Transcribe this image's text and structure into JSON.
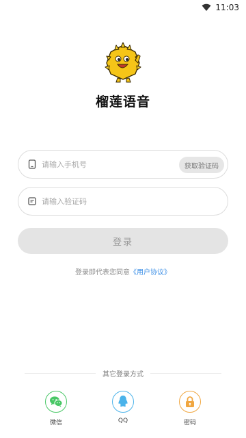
{
  "status_bar": {
    "time": "11:03"
  },
  "app": {
    "name": "榴莲语音"
  },
  "phone_field": {
    "placeholder": "请输入手机号",
    "value": ""
  },
  "code_field": {
    "placeholder": "请输入验证码",
    "value": ""
  },
  "get_code_label": "获取验证码",
  "login_label": "登录",
  "agreement": {
    "prefix": "登录即代表您同意",
    "link": "《用户协议》"
  },
  "other_login": {
    "title": "其它登录方式",
    "options": [
      {
        "label": "微信",
        "icon": "wechat-icon",
        "color": "#49c766"
      },
      {
        "label": "QQ",
        "icon": "qq-icon",
        "color": "#4bb3ea"
      },
      {
        "label": "密码",
        "icon": "lock-icon",
        "color": "#f0a640"
      }
    ]
  },
  "colors": {
    "link": "#3a8ee6",
    "button_disabled": "#e4e4e4",
    "logo": "#f5c518"
  }
}
